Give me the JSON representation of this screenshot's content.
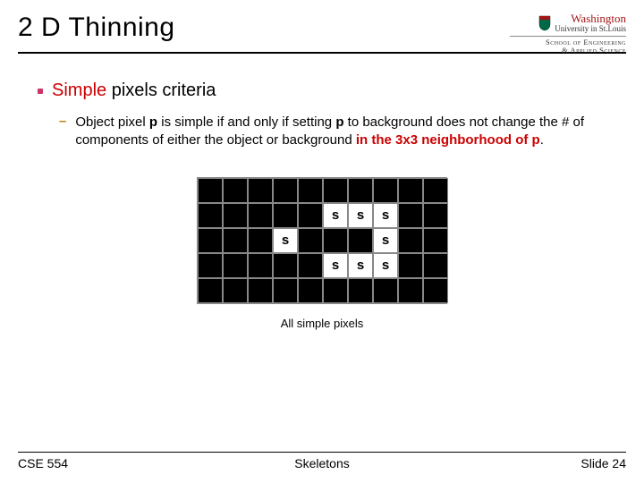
{
  "title": "2 D Thinning",
  "logo": {
    "university": "Washington",
    "subline": "University in St.Louis",
    "school_l1": "School of Engineering",
    "school_l2": "& Applied Science"
  },
  "bullet": {
    "lead": "Simple",
    "rest": " pixels criteria"
  },
  "sub": {
    "p1": "Object pixel ",
    "p2": "p",
    "p3": " is simple if and only if setting ",
    "p4": "p",
    "p5": " to background does not change the # of components of either the object or background ",
    "p6": "in the 3x3 neighborhood of p",
    "p7": "."
  },
  "grid": {
    "rows": 5,
    "cols": 10,
    "cells": [
      [
        1,
        1,
        1,
        1,
        1,
        1,
        1,
        1,
        1,
        1
      ],
      [
        1,
        1,
        1,
        1,
        1,
        0,
        0,
        0,
        1,
        1
      ],
      [
        1,
        1,
        1,
        0,
        1,
        1,
        1,
        0,
        1,
        1
      ],
      [
        1,
        1,
        1,
        1,
        1,
        0,
        0,
        0,
        1,
        1
      ],
      [
        1,
        1,
        1,
        1,
        1,
        1,
        1,
        1,
        1,
        1
      ]
    ],
    "labels": [
      [
        "",
        "",
        "",
        "",
        "",
        "",
        "",
        "",
        "",
        ""
      ],
      [
        "",
        "",
        "",
        "",
        "",
        "s",
        "s",
        "s",
        "",
        ""
      ],
      [
        "",
        "",
        "",
        "s",
        "",
        "",
        "",
        "s",
        "",
        ""
      ],
      [
        "",
        "",
        "",
        "",
        "",
        "s",
        "s",
        "s",
        "",
        ""
      ],
      [
        "",
        "",
        "",
        "",
        "",
        "",
        "",
        "",
        "",
        ""
      ]
    ],
    "caption": "All simple pixels"
  },
  "footer": {
    "left": "CSE 554",
    "center": "Skeletons",
    "right": "Slide 24"
  }
}
